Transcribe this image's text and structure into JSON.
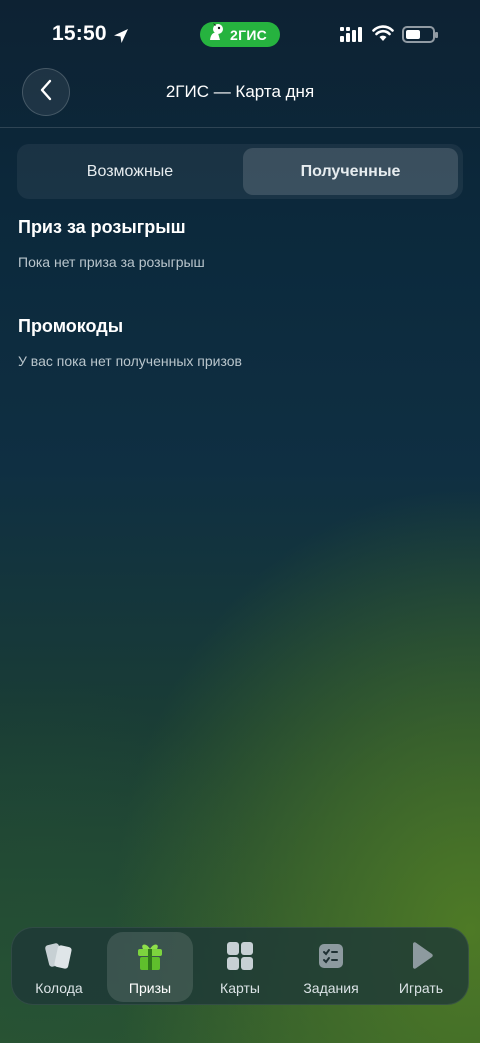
{
  "status_bar": {
    "time": "15:50",
    "app_pill": {
      "label": "2ГИС",
      "color": "#26b33f"
    },
    "icons": [
      "location-arrow-icon",
      "signal-icon",
      "wifi-icon",
      "battery-icon"
    ]
  },
  "header": {
    "title": "2ГИС — Карта дня",
    "back_icon": "chevron-left-icon"
  },
  "segment": {
    "tabs": [
      {
        "label": "Возможные",
        "selected": false
      },
      {
        "label": "Полученные",
        "selected": true
      }
    ]
  },
  "sections": {
    "prize": {
      "title": "Приз за розыгрыш",
      "text": "Пока нет приза за розыгрыш"
    },
    "promo": {
      "title": "Промокоды",
      "text": "У вас пока нет полученных призов"
    }
  },
  "tabbar": {
    "items": [
      {
        "label": "Колода",
        "icon": "cards-deck-icon",
        "active": false
      },
      {
        "label": "Призы",
        "icon": "gift-icon",
        "active": true
      },
      {
        "label": "Карты",
        "icon": "grid-icon",
        "active": false
      },
      {
        "label": "Задания",
        "icon": "checklist-icon",
        "active": false
      },
      {
        "label": "Играть",
        "icon": "play-icon",
        "active": false
      }
    ]
  }
}
